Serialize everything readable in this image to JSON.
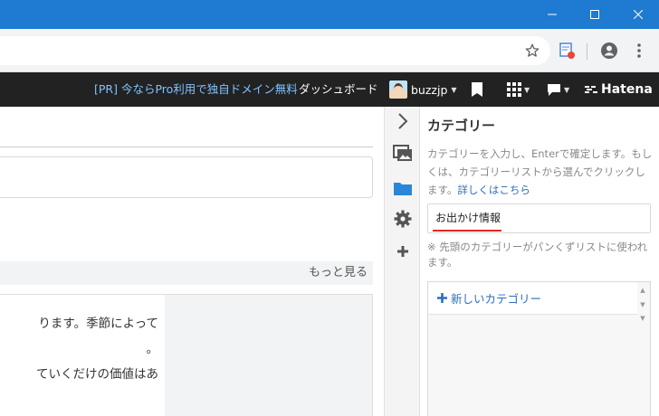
{
  "hatena_bar": {
    "pr_text": "[PR] 今ならPro利用で独自ドメイン無料",
    "dashboard": "ダッシュボード",
    "username": "buzzjp",
    "logo": "Hatena"
  },
  "main": {
    "more_link": "もっと見る",
    "content_lines": [
      "ります。季節によって",
      "。",
      "ていくだけの価値はあ"
    ]
  },
  "panel": {
    "title": "カテゴリー",
    "description": "カテゴリーを入力し、Enterで確定します。もしくは、カテゴリーリストから選んでクリックします。",
    "description_link": "詳しくはこちら",
    "input_value": "お出かけ情報",
    "note": "※ 先頭のカテゴリーがパンくずリストに使われます。",
    "new_category": "新しいカテゴリー"
  },
  "colors": {
    "titlebar": "#1f7ad1",
    "hatena_bar": "#222222",
    "pr_link": "#80c2ff",
    "link_blue": "#2c6ebd",
    "underline_red": "#e8261f"
  },
  "icons": {
    "rail": [
      "chevron-right-icon",
      "image-icon",
      "folder-icon",
      "gear-icon",
      "plus-icon"
    ]
  }
}
